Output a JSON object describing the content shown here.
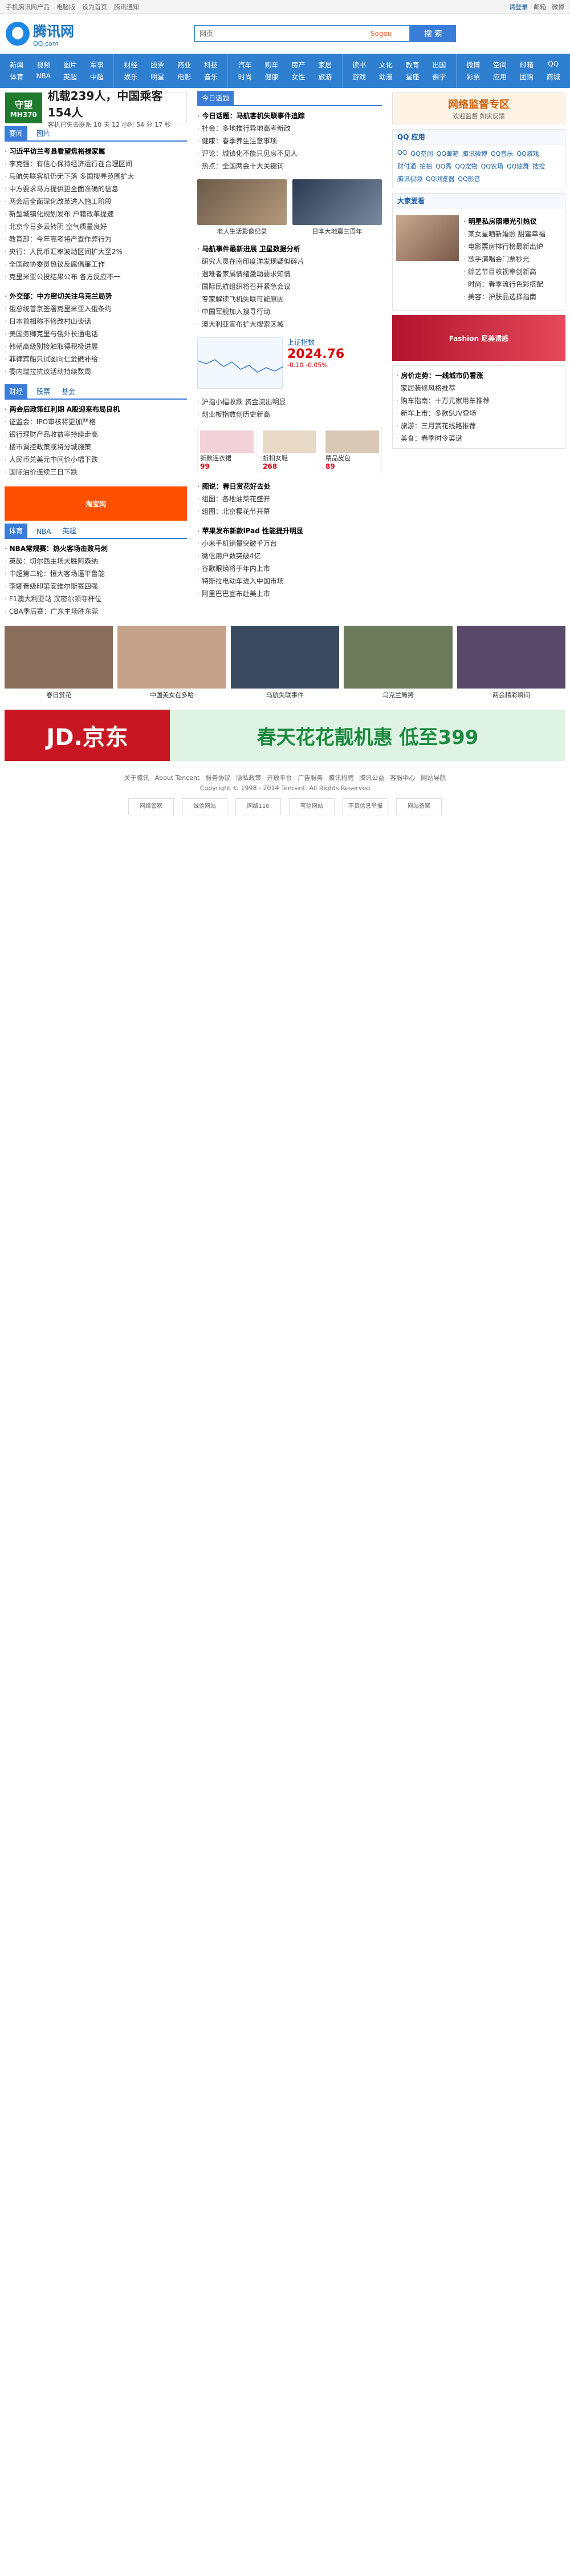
{
  "topbar": {
    "links_left": [
      "手机腾讯网产品",
      "电脑版",
      "设为首页",
      "腾讯通知"
    ],
    "links_right": [
      "请登录",
      "邮箱",
      "微博"
    ]
  },
  "header": {
    "logo_name": "腾讯网",
    "logo_domain": "QQ.com",
    "search_placeholder": "网页",
    "sogou_label": "Sogou",
    "search_button": "搜 索"
  },
  "nav": {
    "groups": [
      [
        "新闻",
        "视频",
        "图片",
        "军事",
        "体育",
        "NBA",
        "英超",
        "中超"
      ],
      [
        "财经",
        "股票",
        "商业",
        "科技",
        "娱乐",
        "明星",
        "电影",
        "音乐"
      ],
      [
        "汽车",
        "购车",
        "房产",
        "家居",
        "时尚",
        "健康",
        "女性",
        "旅游"
      ],
      [
        "读书",
        "文化",
        "教育",
        "出国",
        "游戏",
        "动漫",
        "星座",
        "佛学"
      ],
      [
        "微博",
        "空间",
        "邮箱",
        "QQ",
        "彩票",
        "应用",
        "团购",
        "商城"
      ]
    ]
  },
  "banner": {
    "tag_top": "守望",
    "tag_bottom": "MH370",
    "headline": "机载239人，中国乘客154人",
    "sub": "客机已失去联系 10 天 12 小时 54 分 17 秒",
    "right_title": "网络监督专区",
    "right_sub": "欢迎监督 如实反馈"
  },
  "col1": {
    "sec_news": {
      "tabs": [
        "要闻",
        "图片"
      ]
    },
    "news_list_1": [
      {
        "t": "习近平访兰考县看望焦裕禄家属",
        "hl": true
      },
      {
        "t": "李克强：有信心保持经济运行在合理区间",
        "hl": false
      },
      {
        "t": "马航失联客机仍无下落 多国搜寻范围扩大",
        "hl": false
      },
      {
        "t": "中方要求马方提供更全面准确的信息",
        "hl": false
      },
      {
        "t": "两会后全面深化改革进入施工阶段",
        "hl": false
      },
      {
        "t": "新型城镇化规划发布 户籍改革提速",
        "hl": false
      },
      {
        "t": "北京今日多云转阴 空气质量良好",
        "hl": false
      },
      {
        "t": "教育部：今年高考将严查作弊行为",
        "hl": false
      },
      {
        "t": "央行：人民币汇率波动区间扩大至2%",
        "hl": false
      },
      {
        "t": "全国政协委员热议反腐倡廉工作",
        "hl": false
      },
      {
        "t": "克里米亚公投结果公布 各方反应不一",
        "hl": false
      }
    ],
    "news_list_2": [
      {
        "t": "外交部：中方密切关注乌克兰局势",
        "hl": true
      },
      {
        "t": "俄总统普京签署克里米亚入俄条约",
        "hl": false
      },
      {
        "t": "日本首相称不修改村山谈话",
        "hl": false
      },
      {
        "t": "美国务卿克里与俄外长通电话",
        "hl": false
      },
      {
        "t": "韩朝高级别接触取得积极进展",
        "hl": false
      },
      {
        "t": "菲律宾船只试图向仁爱礁补给",
        "hl": false
      },
      {
        "t": "委内瑞拉抗议活动持续数周",
        "hl": false
      }
    ],
    "finance_tabs": [
      "财经",
      "股票",
      "基金"
    ],
    "finance_list": [
      {
        "t": "两会后政策红利期 A股迎来布局良机",
        "hl": true
      },
      {
        "t": "证监会：IPO审核将更加严格",
        "hl": false
      },
      {
        "t": "银行理财产品收益率持续走高",
        "hl": false
      },
      {
        "t": "楼市调控政策或将分城施策",
        "hl": false
      },
      {
        "t": "人民币兑美元中间价小幅下跌",
        "hl": false
      },
      {
        "t": "国际油价连续三日下跌",
        "hl": false
      }
    ],
    "ad_label": "淘宝网",
    "sports_tabs": [
      "体育",
      "NBA",
      "英超"
    ],
    "sports_list": [
      {
        "t": "NBA常规赛：热火客场击败马刺",
        "hl": true
      },
      {
        "t": "英超：切尔西主场大胜阿森纳",
        "hl": false
      },
      {
        "t": "中超第二轮：恒大客场逼平鲁能",
        "hl": false
      },
      {
        "t": "李娜晋级印第安维尔斯赛四强",
        "hl": false
      },
      {
        "t": "F1澳大利亚站 汉密尔顿夺杆位",
        "hl": false
      },
      {
        "t": "CBA季后赛：广东主场胜东莞",
        "hl": false
      }
    ]
  },
  "col2": {
    "sec_title": [
      "今日话题"
    ],
    "topic_list": [
      {
        "t": "今日话题：马航客机失联事件追踪",
        "hl": true
      },
      {
        "t": "社会：多地推行异地高考新政",
        "hl": false
      },
      {
        "t": "健康：春季养生注意事项",
        "hl": false
      },
      {
        "t": "评论：城镇化不能只见房不见人",
        "hl": false
      },
      {
        "t": "热点：全国两会十大关键词",
        "hl": false
      }
    ],
    "thumbs": [
      {
        "cap": "老人生活影像纪录"
      },
      {
        "cap": "日本大地震三周年"
      }
    ],
    "news_list": [
      {
        "t": "马航事件最新进展 卫星数据分析",
        "hl": true
      },
      {
        "t": "研究人员在南印度洋发现疑似碎片",
        "hl": false
      },
      {
        "t": "遇难者家属情绪激动要求知情",
        "hl": false
      },
      {
        "t": "国际民航组织将召开紧急会议",
        "hl": false
      },
      {
        "t": "专家解读飞机失联可能原因",
        "hl": false
      },
      {
        "t": "中国军舰加入搜寻行动",
        "hl": false
      },
      {
        "t": "澳大利亚宣布扩大搜索区域",
        "hl": false
      }
    ],
    "stock": {
      "label": "上证指数",
      "value": "2024.76",
      "change": "-0.10",
      "pct": "-0.05%"
    },
    "stock_news": [
      {
        "t": "沪指小幅收跌 资金流出明显",
        "hl": false
      },
      {
        "t": "创业板指数创历史新高",
        "hl": false
      }
    ],
    "ad_labels": [
      "新款连衣裙",
      "折扣女鞋",
      "精品皮包"
    ],
    "ad_prices": [
      "99",
      "268",
      "89"
    ],
    "pic_news": [
      {
        "t": "图说：春日赏花好去处",
        "hl": true
      },
      {
        "t": "组图：各地油菜花盛开",
        "hl": false
      },
      {
        "t": "组图：北京樱花节开幕",
        "hl": false
      }
    ],
    "lower_list": [
      {
        "t": "苹果发布新款iPad 性能提升明显",
        "hl": true
      },
      {
        "t": "小米手机销量突破千万台",
        "hl": false
      },
      {
        "t": "微信用户数突破4亿",
        "hl": false
      },
      {
        "t": "谷歌眼镜将于年内上市",
        "hl": false
      },
      {
        "t": "特斯拉电动车进入中国市场",
        "hl": false
      },
      {
        "t": "阿里巴巴宣布赴美上市",
        "hl": false
      }
    ]
  },
  "col3": {
    "qq_box_title": "QQ 应用",
    "qq_tags": [
      "QQ",
      "QQ空间",
      "QQ邮箱",
      "腾讯微博",
      "QQ音乐",
      "QQ游戏",
      "财付通",
      "拍拍",
      "QQ秀",
      "QQ宠物",
      "QQ农场",
      "QQ炫舞",
      "搜搜",
      "腾讯视频",
      "QQ浏览器",
      "QQ影音"
    ],
    "star_title": "大家爱看",
    "star_list": [
      {
        "t": "明星私房照曝光引热议",
        "hl": true
      },
      {
        "t": "某女星晒新婚照 甜蜜幸福",
        "hl": false
      },
      {
        "t": "电影票房排行榜最新出炉",
        "hl": false
      },
      {
        "t": "歌手演唱会门票秒光",
        "hl": false
      },
      {
        "t": "综艺节目收视率创新高",
        "hl": false
      },
      {
        "t": "时尚：春季流行色彩搭配",
        "hl": false
      },
      {
        "t": "美容：护肤品选择指南",
        "hl": false
      }
    ],
    "ad_label": "Fashion 尼美诱惑",
    "side_list": [
      {
        "t": "房价走势：一线城市仍看涨",
        "hl": true
      },
      {
        "t": "家居装修风格推荐",
        "hl": false
      },
      {
        "t": "购车指南：十万元家用车推荐",
        "hl": false
      },
      {
        "t": "新车上市：多款SUV登场",
        "hl": false
      },
      {
        "t": "旅游：三月赏花线路推荐",
        "hl": false
      },
      {
        "t": "美食：春季时令菜谱",
        "hl": false
      }
    ]
  },
  "gallery": [
    {
      "cap": "春日赏花"
    },
    {
      "cap": "中国美女在多哈"
    },
    {
      "cap": "马航失联事件"
    },
    {
      "cap": "乌克兰局势"
    },
    {
      "cap": "两会精彩瞬间"
    }
  ],
  "jd": {
    "left": "JD.京东",
    "right": "春天花花靓机惠 低至399"
  },
  "footer": {
    "links": [
      "关于腾讯",
      "About Tencent",
      "服务协议",
      "隐私政策",
      "开放平台",
      "广告服务",
      "腾讯招聘",
      "腾讯公益",
      "客服中心",
      "网站导航"
    ],
    "copy": "Copyright © 1998 - 2014 Tencent. All Rights Reserved",
    "badges": [
      "网络警察",
      "诚信网站",
      "网络110",
      "可信网站",
      "不良信息举报",
      "网站备案"
    ]
  },
  "colors": {
    "accent": "#3a7dd8",
    "nav": "#2f7fd1",
    "red": "#d00"
  }
}
